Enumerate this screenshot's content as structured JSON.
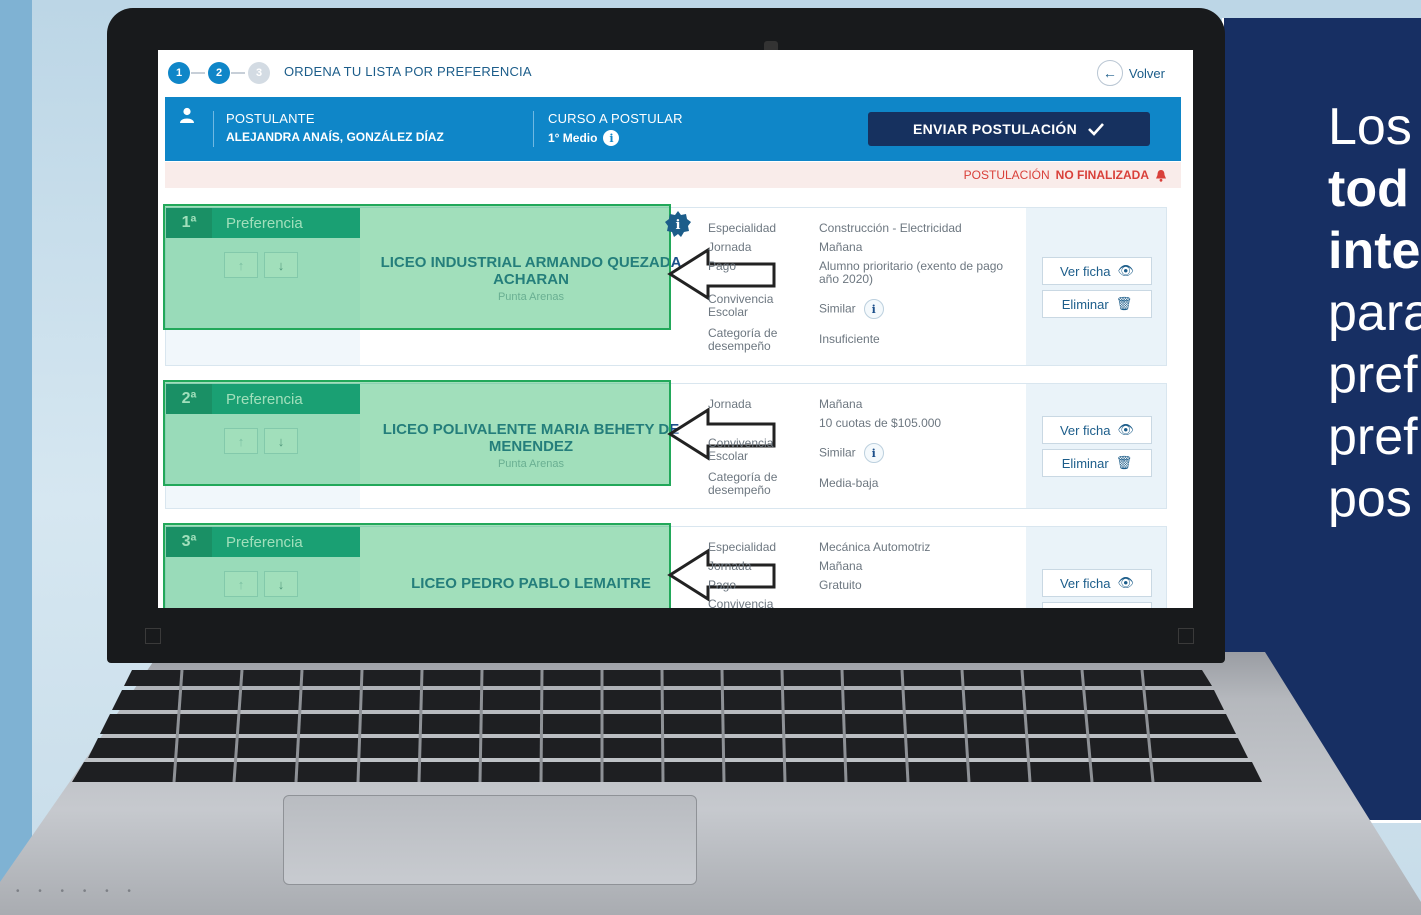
{
  "steps": [
    "1",
    "2",
    "3"
  ],
  "steps_title": "ORDENA TU LISTA POR PREFERENCIA",
  "back_label": "Volver",
  "header": {
    "applicant_label": "POSTULANTE",
    "applicant_name": "ALEJANDRA ANAÍS, GONZÁLEZ DÍAZ",
    "course_label": "CURSO A POSTULAR",
    "course_value": "1° Medio",
    "send_label": "ENVIAR POSTULACIÓN"
  },
  "status": {
    "prefix": "POSTULACIÓN",
    "emphasis": "NO FINALIZADA"
  },
  "preferences": [
    {
      "rank": "1ª",
      "label": "Preferencia",
      "school": "LICEO INDUSTRIAL ARMANDO QUEZADA ACHARAN",
      "city": "Punta Arenas",
      "attributes": [
        {
          "k": "Especialidad",
          "v": "Construcción - Electricidad"
        },
        {
          "k": "Jornada",
          "v": "Mañana"
        },
        {
          "k": "Pago",
          "v": "Alumno prioritario (exento de pago año 2020)"
        },
        {
          "k": "Convivencia Escolar",
          "v": "Similar"
        },
        {
          "k": "Categoría de desempeño",
          "v": "Insuficiente"
        }
      ],
      "view_label": "Ver ficha",
      "delete_label": "Eliminar"
    },
    {
      "rank": "2ª",
      "label": "Preferencia",
      "school": "LICEO POLIVALENTE MARIA BEHETY DE MENENDEZ",
      "city": "Punta Arenas",
      "attributes": [
        {
          "k": "Jornada",
          "v": "Mañana"
        },
        {
          "k": "",
          "v": "10 cuotas de $105.000"
        },
        {
          "k": "Convivencia Escolar",
          "v": "Similar"
        },
        {
          "k": "Categoría de desempeño",
          "v": "Media-baja"
        }
      ],
      "view_label": "Ver ficha",
      "delete_label": "Eliminar"
    },
    {
      "rank": "3ª",
      "label": "Preferencia",
      "school": "LICEO PEDRO PABLO LEMAITRE",
      "city": "",
      "attributes": [
        {
          "k": "Especialidad",
          "v": "Mecánica Automotriz"
        },
        {
          "k": "Jornada",
          "v": "Mañana"
        },
        {
          "k": "Pago",
          "v": "Gratuito"
        },
        {
          "k": "Convivencia",
          "v": ""
        }
      ],
      "view_label": "Ver ficha",
      "delete_label": ""
    }
  ],
  "side_text": {
    "line1": "Los",
    "line2": "tod",
    "line3": "inte",
    "line4": "para",
    "line5": "pref",
    "line6": "pref",
    "line7": "pos"
  },
  "colors": {
    "header_blue": "#0f86c8",
    "navy": "#16315f",
    "teal": "#0a8d7d",
    "overlay_green": "#2eb868",
    "alert_red": "#d9403a",
    "panel_navy": "#172f63"
  }
}
